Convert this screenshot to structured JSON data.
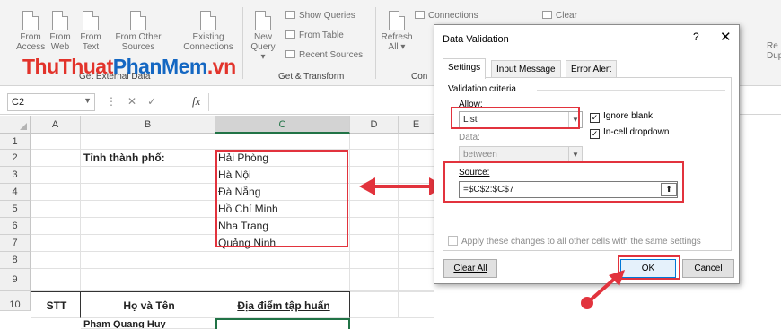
{
  "ribbon": {
    "buttons": [
      {
        "line1": "From",
        "line2": "Access"
      },
      {
        "line1": "From",
        "line2": "Web"
      },
      {
        "line1": "From",
        "line2": "Text"
      },
      {
        "line1": "From Other",
        "line2": "Sources"
      },
      {
        "line1": "Existing",
        "line2": "Connections"
      }
    ],
    "new_query_l1": "New",
    "new_query_l2": "Query",
    "show_queries": "Show Queries",
    "from_table": "From Table",
    "recent_sources": "Recent Sources",
    "refresh_l1": "Refresh",
    "refresh_l2": "All",
    "connections": "Connections",
    "clear": "Clear",
    "group_get_external": "Get External Data",
    "group_get_transform": "Get & Transform",
    "group_con": "Con",
    "right_cut_1": "Re",
    "right_cut_2": "Dup"
  },
  "logo": {
    "part1": "ThuThuat",
    "part2": "PhanMem",
    "part3": ".vn"
  },
  "formula_bar": {
    "name_box": "C2",
    "fx": "fx"
  },
  "grid": {
    "columns": [
      "A",
      "B",
      "C",
      "D",
      "E"
    ],
    "rows": [
      "1",
      "2",
      "3",
      "4",
      "5",
      "6",
      "7",
      "8",
      "9",
      "10"
    ],
    "b2": "Tỉnh thành phố:",
    "c_values": [
      "Hải Phòng",
      "Hà Nội",
      "Đà Nẵng",
      "Hồ Chí Minh",
      "Nha Trang",
      "Quảng Ninh"
    ],
    "a10": "STT",
    "b10": "Họ và Tên",
    "c10": "Địa điểm tập huấn",
    "b11_partial": "Phạm Quang Huy"
  },
  "dialog": {
    "title": "Data Validation",
    "help": "?",
    "close": "✕",
    "tabs": [
      "Settings",
      "Input Message",
      "Error Alert"
    ],
    "criteria_label": "Validation criteria",
    "allow_label": "Allow:",
    "allow_value": "List",
    "ignore_blank": "Ignore blank",
    "in_cell_dropdown": "In-cell dropdown",
    "data_label": "Data:",
    "data_value": "between",
    "source_label": "Source:",
    "source_value": "=$C$2:$C$7",
    "apply_all": "Apply these changes to all other cells with the same settings",
    "clear_all": "Clear All",
    "ok": "OK",
    "cancel": "Cancel"
  },
  "colors": {
    "accent_red": "#e2333d",
    "excel_green": "#217346"
  }
}
